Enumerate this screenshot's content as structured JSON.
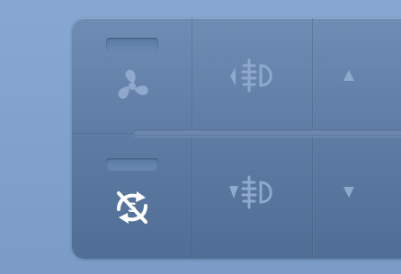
{
  "panel": {
    "buttons": [
      {
        "id": "fan",
        "icon": "fan-icon",
        "indicator_on": false,
        "active": false
      },
      {
        "id": "headlight-up",
        "icon": "headlight-level-up-icon",
        "active": false
      },
      {
        "id": "arrow-up",
        "icon": "arrow-up-icon",
        "active": false
      },
      {
        "id": "recirculation-off",
        "icon": "recirculation-off-icon",
        "indicator_on": false,
        "active": true
      },
      {
        "id": "headlight-down",
        "icon": "headlight-level-down-icon",
        "active": false
      },
      {
        "id": "arrow-down",
        "icon": "arrow-down-icon",
        "active": false
      }
    ]
  },
  "colors": {
    "background": "#86a8d2",
    "panel": "#5d7ba3",
    "icon_dim": "#8ea9cc",
    "icon_active": "#ffffff"
  }
}
